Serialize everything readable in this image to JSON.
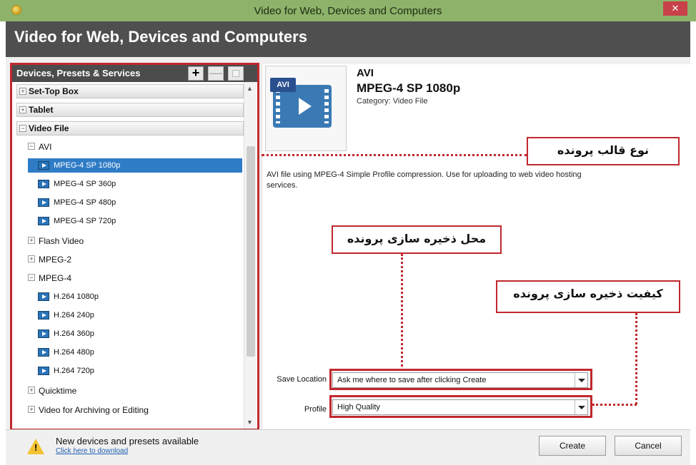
{
  "window": {
    "title": "Video for Web, Devices and Computers",
    "close": "✕"
  },
  "header": {
    "title": "Video for Web, Devices and Computers"
  },
  "left_panel": {
    "title": "Devices, Presets & Services",
    "add": "+",
    "remove": "—",
    "tree": {
      "set_top_box": "Set-Top Box",
      "tablet": "Tablet",
      "video_file": "Video File",
      "avi": "AVI",
      "avi_items": [
        "MPEG-4 SP 1080p",
        "MPEG-4 SP 360p",
        "MPEG-4 SP 480p",
        "MPEG-4 SP 720p"
      ],
      "flash_video": "Flash Video",
      "mpeg2": "MPEG-2",
      "mpeg4": "MPEG-4",
      "mpeg4_items": [
        "H.264 1080p",
        "H.264 240p",
        "H.264 360p",
        "H.264 480p",
        "H.264 720p"
      ],
      "quicktime": "Quicktime",
      "archiving": "Video for Archiving or Editing"
    }
  },
  "detail": {
    "thumb_tag": "AVI",
    "format": "AVI",
    "profile_name": "MPEG-4 SP 1080p",
    "category": "Category: Video File",
    "description": "AVI file using MPEG-4 Simple Profile compression. Use for uploading to web video hosting services."
  },
  "annotations": {
    "file_format": "نوع قالب پرونده",
    "save_location": "محل ذخیره سازی پرونده",
    "save_quality": "کیفیت ذخیره سازی پرونده"
  },
  "fields": {
    "save_location_label": "Save Location",
    "save_location_value": "Ask me where to save after clicking Create",
    "profile_label": "Profile",
    "profile_value": "High Quality"
  },
  "footer": {
    "news_title": "New devices and presets available",
    "news_link": "Click here to download",
    "create": "Create",
    "cancel": "Cancel"
  },
  "colors": {
    "titlebar": "#8db36a",
    "header": "#4f4f4f",
    "selection": "#2f7cc6",
    "annotation": "#c0282e"
  }
}
